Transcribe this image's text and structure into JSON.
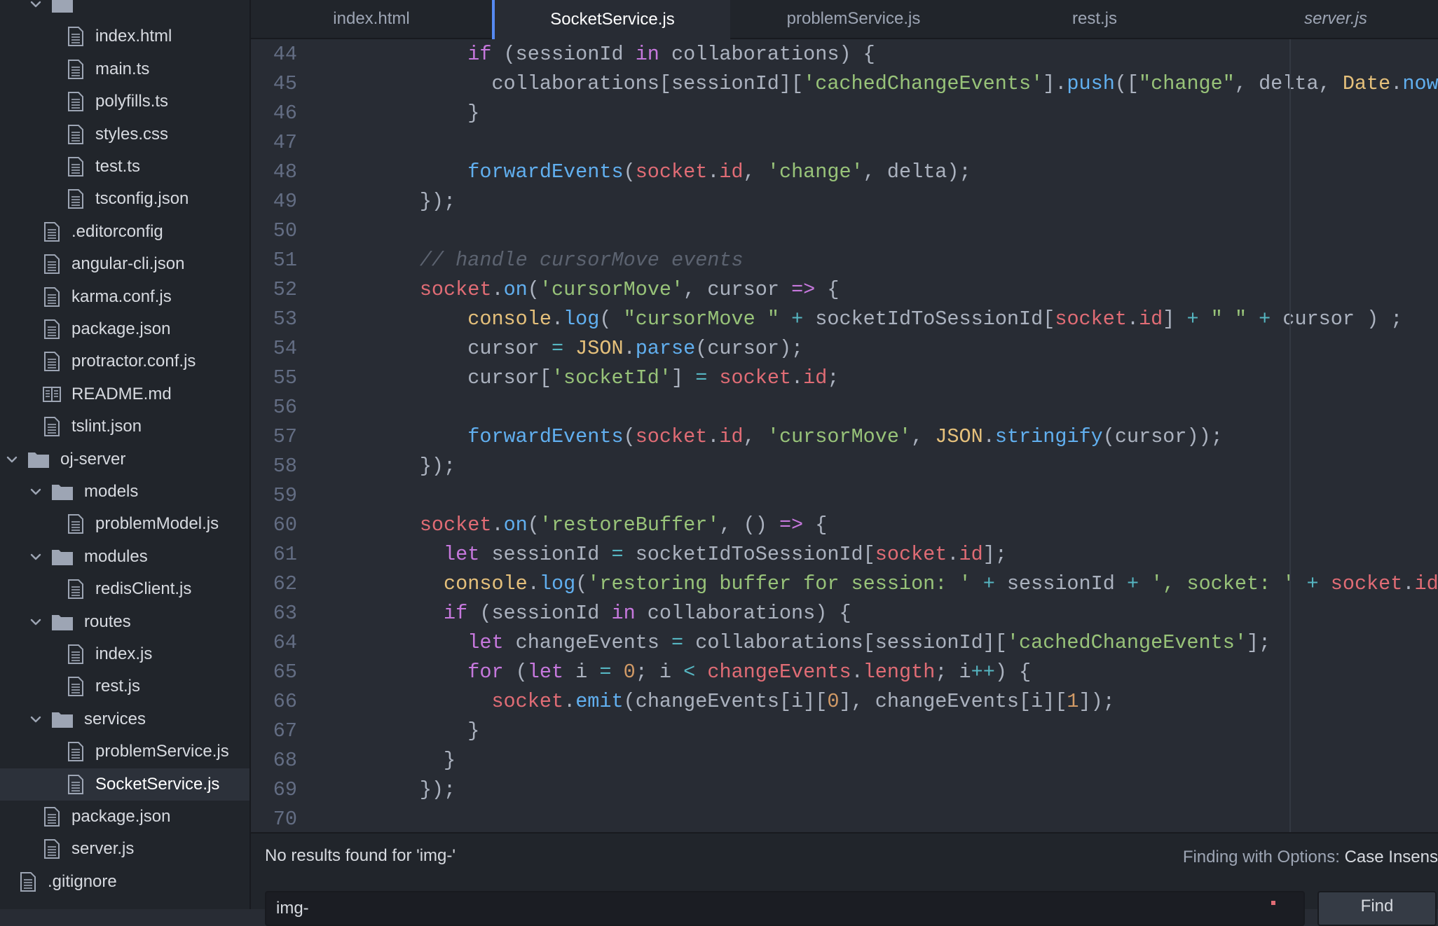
{
  "tabs": [
    {
      "label": "index.html",
      "active": false
    },
    {
      "label": "SocketService.js",
      "active": true
    },
    {
      "label": "problemService.js",
      "active": false
    },
    {
      "label": "rest.js",
      "active": false
    },
    {
      "label": "server.js",
      "active": false,
      "preview": true
    }
  ],
  "sidebar": {
    "items": [
      {
        "label": "",
        "type": "folder",
        "depth": 2,
        "expanded": true
      },
      {
        "label": "index.html",
        "type": "file",
        "depth": 3
      },
      {
        "label": "main.ts",
        "type": "file",
        "depth": 3
      },
      {
        "label": "polyfills.ts",
        "type": "file",
        "depth": 3
      },
      {
        "label": "styles.css",
        "type": "file",
        "depth": 3
      },
      {
        "label": "test.ts",
        "type": "file",
        "depth": 3
      },
      {
        "label": "tsconfig.json",
        "type": "file",
        "depth": 3
      },
      {
        "label": ".editorconfig",
        "type": "file",
        "depth": 2
      },
      {
        "label": "angular-cli.json",
        "type": "file",
        "depth": 2
      },
      {
        "label": "karma.conf.js",
        "type": "file",
        "depth": 2
      },
      {
        "label": "package.json",
        "type": "file",
        "depth": 2
      },
      {
        "label": "protractor.conf.js",
        "type": "file",
        "depth": 2
      },
      {
        "label": "README.md",
        "type": "book",
        "depth": 2
      },
      {
        "label": "tslint.json",
        "type": "file",
        "depth": 2
      },
      {
        "label": "oj-server",
        "type": "folder",
        "depth": 1,
        "expanded": true
      },
      {
        "label": "models",
        "type": "folder",
        "depth": 2,
        "expanded": true
      },
      {
        "label": "problemModel.js",
        "type": "file",
        "depth": 3
      },
      {
        "label": "modules",
        "type": "folder",
        "depth": 2,
        "expanded": true
      },
      {
        "label": "redisClient.js",
        "type": "file",
        "depth": 3
      },
      {
        "label": "routes",
        "type": "folder",
        "depth": 2,
        "expanded": true
      },
      {
        "label": "index.js",
        "type": "file",
        "depth": 3
      },
      {
        "label": "rest.js",
        "type": "file",
        "depth": 3
      },
      {
        "label": "services",
        "type": "folder",
        "depth": 2,
        "expanded": true
      },
      {
        "label": "problemService.js",
        "type": "file",
        "depth": 3
      },
      {
        "label": "SocketService.js",
        "type": "file",
        "depth": 3,
        "selected": true
      },
      {
        "label": "package.json",
        "type": "file",
        "depth": 2
      },
      {
        "label": "server.js",
        "type": "file",
        "depth": 2
      },
      {
        "label": ".gitignore",
        "type": "file",
        "depth": 1
      }
    ]
  },
  "editor": {
    "lines": [
      {
        "no": "44",
        "tokens": [
          [
            "",
            "            "
          ],
          [
            "k",
            "if"
          ],
          [
            "",
            " (sessionId "
          ],
          [
            "k",
            "in"
          ],
          [
            "",
            " collaborations) {"
          ]
        ]
      },
      {
        "no": "45",
        "tokens": [
          [
            "",
            "              collaborations[sessionId]["
          ],
          [
            "s",
            "'cachedChangeEvents'"
          ],
          [
            "",
            "]."
          ],
          [
            "f",
            "push"
          ],
          [
            "",
            "(["
          ],
          [
            "s",
            "\"change\""
          ],
          [
            "",
            ", delta, "
          ],
          [
            "y",
            "Date"
          ],
          [
            "",
            "."
          ],
          [
            "f",
            "now"
          ]
        ]
      },
      {
        "no": "46",
        "tokens": [
          [
            "",
            "            }"
          ]
        ]
      },
      {
        "no": "47",
        "tokens": []
      },
      {
        "no": "48",
        "tokens": [
          [
            "",
            "            "
          ],
          [
            "f",
            "forwardEvents"
          ],
          [
            "",
            "("
          ],
          [
            "v",
            "socket"
          ],
          [
            "",
            "."
          ],
          [
            "v",
            "id"
          ],
          [
            "",
            ", "
          ],
          [
            "s",
            "'change'"
          ],
          [
            "",
            ", delta);"
          ]
        ]
      },
      {
        "no": "49",
        "tokens": [
          [
            "",
            "        });"
          ]
        ]
      },
      {
        "no": "50",
        "tokens": []
      },
      {
        "no": "51",
        "tokens": [
          [
            "",
            "        "
          ],
          [
            "c",
            "// handle cursorMove events"
          ]
        ]
      },
      {
        "no": "52",
        "tokens": [
          [
            "",
            "        "
          ],
          [
            "v",
            "socket"
          ],
          [
            "",
            "."
          ],
          [
            "f",
            "on"
          ],
          [
            "",
            "("
          ],
          [
            "s",
            "'cursorMove'"
          ],
          [
            "",
            ", cursor "
          ],
          [
            "k",
            "=>"
          ],
          [
            "",
            " {"
          ]
        ]
      },
      {
        "no": "53",
        "tokens": [
          [
            "",
            "            "
          ],
          [
            "y",
            "console"
          ],
          [
            "",
            "."
          ],
          [
            "f",
            "log"
          ],
          [
            "",
            "( "
          ],
          [
            "s",
            "\"cursorMove \""
          ],
          [
            "",
            " "
          ],
          [
            "o",
            "+"
          ],
          [
            "",
            " socketIdToSessionId["
          ],
          [
            "v",
            "socket"
          ],
          [
            "",
            "."
          ],
          [
            "v",
            "id"
          ],
          [
            "",
            "] "
          ],
          [
            "o",
            "+"
          ],
          [
            "",
            " "
          ],
          [
            "s",
            "\" \""
          ],
          [
            "",
            " "
          ],
          [
            "o",
            "+"
          ],
          [
            "",
            " cursor ) ;"
          ]
        ]
      },
      {
        "no": "54",
        "tokens": [
          [
            "",
            "            cursor "
          ],
          [
            "o",
            "="
          ],
          [
            "",
            " "
          ],
          [
            "y",
            "JSON"
          ],
          [
            "",
            "."
          ],
          [
            "f",
            "parse"
          ],
          [
            "",
            "(cursor);"
          ]
        ]
      },
      {
        "no": "55",
        "tokens": [
          [
            "",
            "            cursor["
          ],
          [
            "s",
            "'socketId'"
          ],
          [
            "",
            "] "
          ],
          [
            "o",
            "="
          ],
          [
            "",
            " "
          ],
          [
            "v",
            "socket"
          ],
          [
            "",
            "."
          ],
          [
            "v",
            "id"
          ],
          [
            "",
            ";"
          ]
        ]
      },
      {
        "no": "56",
        "tokens": []
      },
      {
        "no": "57",
        "tokens": [
          [
            "",
            "            "
          ],
          [
            "f",
            "forwardEvents"
          ],
          [
            "",
            "("
          ],
          [
            "v",
            "socket"
          ],
          [
            "",
            "."
          ],
          [
            "v",
            "id"
          ],
          [
            "",
            ", "
          ],
          [
            "s",
            "'cursorMove'"
          ],
          [
            "",
            ", "
          ],
          [
            "y",
            "JSON"
          ],
          [
            "",
            "."
          ],
          [
            "f",
            "stringify"
          ],
          [
            "",
            "(cursor));"
          ]
        ]
      },
      {
        "no": "58",
        "tokens": [
          [
            "",
            "        });"
          ]
        ]
      },
      {
        "no": "59",
        "tokens": []
      },
      {
        "no": "60",
        "tokens": [
          [
            "",
            "        "
          ],
          [
            "v",
            "socket"
          ],
          [
            "",
            "."
          ],
          [
            "f",
            "on"
          ],
          [
            "",
            "("
          ],
          [
            "s",
            "'restoreBuffer'"
          ],
          [
            "",
            ", () "
          ],
          [
            "k",
            "=>"
          ],
          [
            "",
            " {"
          ]
        ]
      },
      {
        "no": "61",
        "tokens": [
          [
            "",
            "          "
          ],
          [
            "k",
            "let"
          ],
          [
            "",
            " sessionId "
          ],
          [
            "o",
            "="
          ],
          [
            "",
            " socketIdToSessionId["
          ],
          [
            "v",
            "socket"
          ],
          [
            "",
            "."
          ],
          [
            "v",
            "id"
          ],
          [
            "",
            "];"
          ]
        ]
      },
      {
        "no": "62",
        "tokens": [
          [
            "",
            "          "
          ],
          [
            "y",
            "console"
          ],
          [
            "",
            "."
          ],
          [
            "f",
            "log"
          ],
          [
            "",
            "("
          ],
          [
            "s",
            "'restoring buffer for session: '"
          ],
          [
            "",
            " "
          ],
          [
            "o",
            "+"
          ],
          [
            "",
            " sessionId "
          ],
          [
            "o",
            "+"
          ],
          [
            "",
            " "
          ],
          [
            "s",
            "', socket: '"
          ],
          [
            "",
            " "
          ],
          [
            "o",
            "+"
          ],
          [
            "",
            " "
          ],
          [
            "v",
            "socket"
          ],
          [
            "",
            "."
          ],
          [
            "v",
            "id"
          ]
        ]
      },
      {
        "no": "63",
        "tokens": [
          [
            "",
            "          "
          ],
          [
            "k",
            "if"
          ],
          [
            "",
            " (sessionId "
          ],
          [
            "k",
            "in"
          ],
          [
            "",
            " collaborations) {"
          ]
        ]
      },
      {
        "no": "64",
        "tokens": [
          [
            "",
            "            "
          ],
          [
            "k",
            "let"
          ],
          [
            "",
            " changeEvents "
          ],
          [
            "o",
            "="
          ],
          [
            "",
            " collaborations[sessionId]["
          ],
          [
            "s",
            "'cachedChangeEvents'"
          ],
          [
            "",
            "];"
          ]
        ]
      },
      {
        "no": "65",
        "tokens": [
          [
            "",
            "            "
          ],
          [
            "k",
            "for"
          ],
          [
            "",
            " ("
          ],
          [
            "k",
            "let"
          ],
          [
            "",
            " i "
          ],
          [
            "o",
            "="
          ],
          [
            "",
            " "
          ],
          [
            "n",
            "0"
          ],
          [
            "",
            "; i "
          ],
          [
            "o",
            "<"
          ],
          [
            "",
            " "
          ],
          [
            "v",
            "changeEvents"
          ],
          [
            "",
            "."
          ],
          [
            "v",
            "length"
          ],
          [
            "",
            "; i"
          ],
          [
            "o",
            "++"
          ],
          [
            "",
            ") {"
          ]
        ]
      },
      {
        "no": "66",
        "tokens": [
          [
            "",
            "              "
          ],
          [
            "v",
            "socket"
          ],
          [
            "",
            "."
          ],
          [
            "f",
            "emit"
          ],
          [
            "",
            "(changeEvents[i]["
          ],
          [
            "n",
            "0"
          ],
          [
            "",
            "], changeEvents[i]["
          ],
          [
            "n",
            "1"
          ],
          [
            "",
            "]);"
          ]
        ]
      },
      {
        "no": "67",
        "tokens": [
          [
            "",
            "            }"
          ]
        ]
      },
      {
        "no": "68",
        "tokens": [
          [
            "",
            "          }"
          ]
        ]
      },
      {
        "no": "69",
        "tokens": [
          [
            "",
            "        });"
          ]
        ]
      },
      {
        "no": "70",
        "tokens": []
      }
    ]
  },
  "find": {
    "status": "No results found for 'img-'",
    "options_label": "Finding with Options:",
    "options_value": "Case Insens",
    "query": "img-",
    "button_label": "Find"
  },
  "colors": {
    "accent": "#568af2",
    "sidebar_bg": "#21252b",
    "editor_bg": "#282c34"
  }
}
